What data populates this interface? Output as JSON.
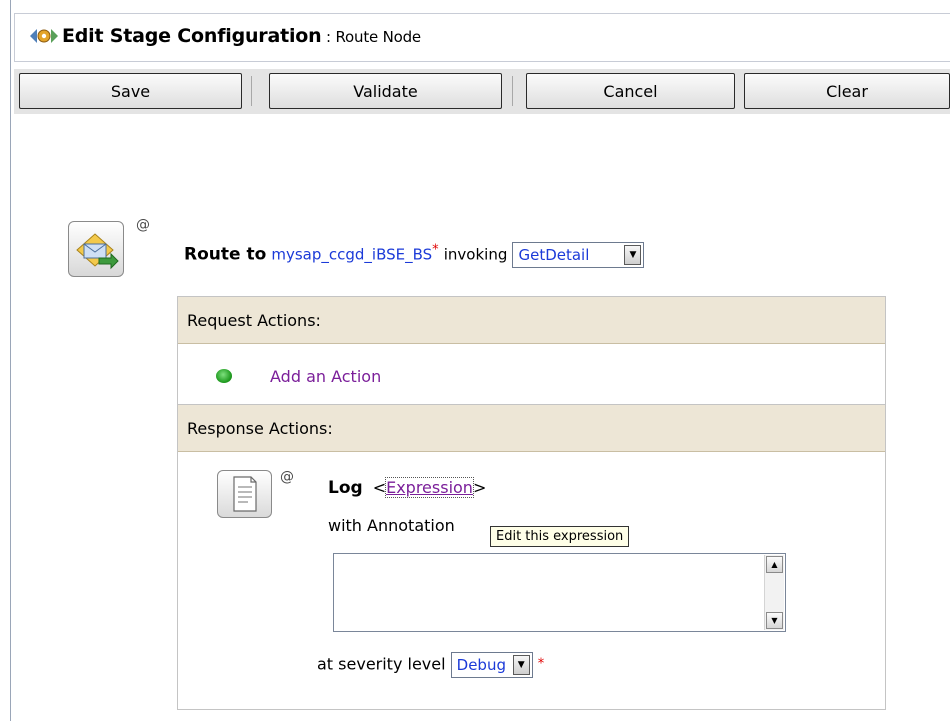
{
  "header": {
    "title": "Edit Stage Configuration",
    "separator": " : ",
    "subtitle": "Route Node"
  },
  "toolbar": {
    "save_label": "Save",
    "validate_label": "Validate",
    "cancel_label": "Cancel",
    "clear_label": "Clear"
  },
  "route": {
    "label": "Route to",
    "service": "mysap_ccgd_iBSE_BS",
    "required_mark": "*",
    "invoking_label": "invoking",
    "operation": "GetDetail",
    "at_sign": "@"
  },
  "request_actions": {
    "heading": "Request Actions:",
    "add_action": "Add an Action"
  },
  "response_actions": {
    "heading": "Response Actions:",
    "log": {
      "label": "Log",
      "expr_open": "<",
      "expression_link": "Expression",
      "expr_close": ">",
      "annotation_label": "with Annotation",
      "tooltip": "Edit this expression",
      "annotation_value": "",
      "severity_label": "at severity level",
      "severity": "Debug",
      "required_mark": "*",
      "at_sign": "@"
    }
  },
  "colors": {
    "link_blue": "#1b3ad8",
    "link_purple": "#7b1f9a",
    "section_header_bg": "#ede6d6",
    "required_red": "#e00000"
  },
  "icons": {
    "header": "config-gear-icon",
    "route": "route-envelope-icon",
    "add": "green-circle-icon",
    "log": "document-icon"
  }
}
